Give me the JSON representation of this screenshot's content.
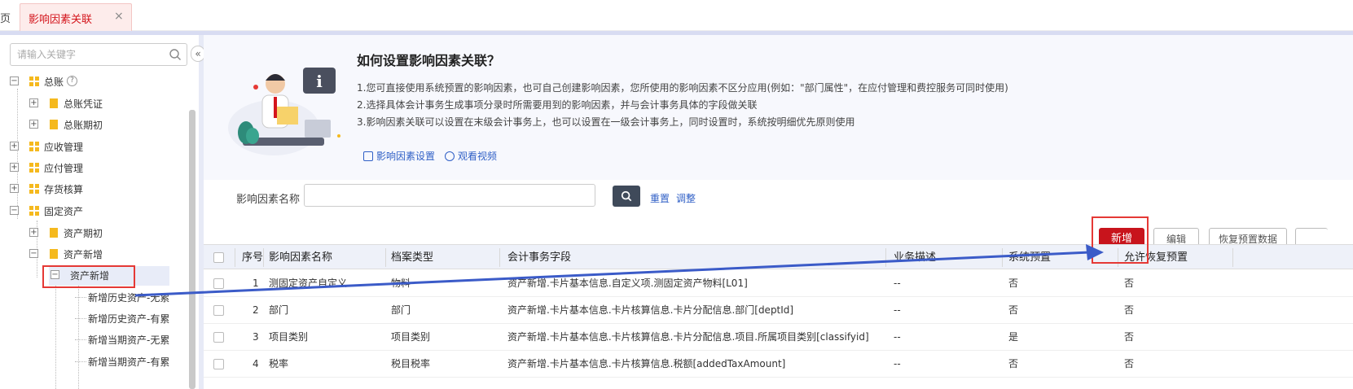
{
  "tabs": {
    "home_label": "页",
    "active_label": "影响因素关联",
    "close_glyph": "×"
  },
  "tree": {
    "search_placeholder": "请输入关键字",
    "collapse_glyph": "«",
    "nodes": [
      {
        "label": "总账",
        "toggle": "−"
      },
      {
        "label": "总账凭证",
        "toggle": "+"
      },
      {
        "label": "总账期初",
        "toggle": "+"
      },
      {
        "label": "应收管理",
        "toggle": "+"
      },
      {
        "label": "应付管理",
        "toggle": "+"
      },
      {
        "label": "存货核算",
        "toggle": "+"
      },
      {
        "label": "固定资产",
        "toggle": "−"
      },
      {
        "label": "资产期初",
        "toggle": "+"
      },
      {
        "label": "资产新增",
        "toggle": "−"
      },
      {
        "label": "资产新增",
        "toggle": "−"
      },
      {
        "label": "新增历史资产-无累"
      },
      {
        "label": "新增历史资产-有累"
      },
      {
        "label": "新增当期资产-无累"
      },
      {
        "label": "新增当期资产-有累"
      }
    ],
    "help_glyph": "?"
  },
  "guide": {
    "title": "如何设置影响因素关联？",
    "lines": [
      "1.您可直接使用系统预置的影响因素，也可自己创建影响因素，您所使用的影响因素不区分应用(例如：\"部门属性\"，在应付管理和费控服务可同时使用)",
      "2.选择具体会计事务生成事项分录时所需要用到的影响因素，并与会计事务具体的字段做关联",
      "3.影响因素关联可以设置在末级会计事务上，也可以设置在一级会计事务上，同时设置时，系统按明细优先原则使用"
    ],
    "link_setting": "影响因素设置",
    "link_video": "观看视频"
  },
  "filter": {
    "label": "影响因素名称",
    "value": "",
    "reset": "重置",
    "adjust": "调整"
  },
  "toolbar": {
    "add": "新增",
    "edit": "编辑",
    "restore": "恢复预置数据"
  },
  "table": {
    "headers": [
      "序号",
      "影响因素名称",
      "档案类型",
      "会计事务字段",
      "业务描述",
      "系统预置",
      "允许恢复预置"
    ],
    "rows": [
      {
        "no": "1",
        "name": "测固定资产自定义",
        "type": "物料",
        "field": "资产新增.卡片基本信息.自定义项.测固定资产物料[L01]",
        "desc": "--",
        "preset": "否",
        "restore": "否"
      },
      {
        "no": "2",
        "name": "部门",
        "type": "部门",
        "field": "资产新增.卡片基本信息.卡片核算信息.卡片分配信息.部门[deptId]",
        "desc": "--",
        "preset": "否",
        "restore": "否"
      },
      {
        "no": "3",
        "name": "项目类别",
        "type": "项目类别",
        "field": "资产新增.卡片基本信息.卡片核算信息.卡片分配信息.项目.所属项目类别[classifyid]",
        "desc": "--",
        "preset": "是",
        "restore": "否"
      },
      {
        "no": "4",
        "name": "税率",
        "type": "税目税率",
        "field": "资产新增.卡片基本信息.卡片核算信息.税额[addedTaxAmount]",
        "desc": "--",
        "preset": "否",
        "restore": "否"
      }
    ]
  },
  "colors": {
    "brand_red": "#c8141c",
    "highlight_red": "#e53935",
    "link_blue": "#2f5fc6",
    "arrow_blue": "#3b5bc8",
    "folder_yellow": "#f5b91e"
  }
}
